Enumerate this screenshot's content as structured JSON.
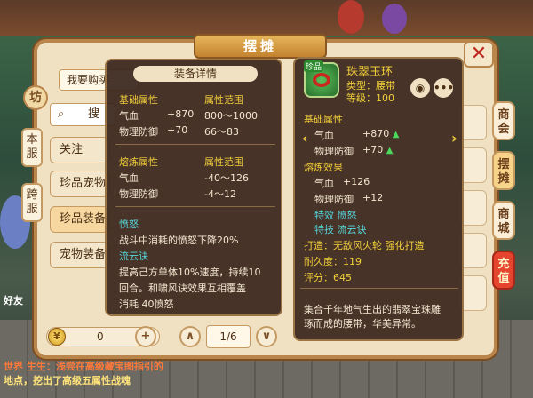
{
  "window": {
    "title": "摆摊"
  },
  "close_icon": "close-x",
  "shop_badge": "坊",
  "left_tabs": [
    "本服",
    "跨服"
  ],
  "want_buy": "我要购买",
  "search": {
    "label": "搜"
  },
  "categories": [
    {
      "label": "关注"
    },
    {
      "label": "珍品宠物"
    },
    {
      "label": "珍品装备"
    },
    {
      "label": "宠物装备"
    }
  ],
  "side_nav": [
    "商会",
    "摆摊",
    "商城",
    "充值"
  ],
  "bottom": {
    "gold_value": "0",
    "add_label": "+",
    "page": "1/6",
    "prev_label": "∧",
    "next_label": "∨"
  },
  "detail": {
    "header": "装备详情",
    "base_title": "基础属性",
    "range_title": "属性范围",
    "base": [
      {
        "name": "气血",
        "value": "+870",
        "range": "800～1000"
      },
      {
        "name": "物理防御",
        "value": "+70",
        "range": "66～83"
      }
    ],
    "refine_title": "熔炼属性",
    "refine_range_title": "属性范围",
    "refine": [
      {
        "name": "气血",
        "range": "-40～126"
      },
      {
        "name": "物理防御",
        "range": "-4～12"
      }
    ],
    "anger_title": "愤怒",
    "anger_text": "战斗中消耗的愤怒下降20%",
    "flow_title": "流云诀",
    "flow_text1": "提高己方单体10%速度，持续10",
    "flow_text2": "回合。和啸风诀效果互相覆盖",
    "flow_text3": "消耗 40愤怒"
  },
  "item": {
    "name": "珠翠玉环",
    "type": "类型：腰带",
    "level": "等级：100",
    "icon_tag": "珍品",
    "base_title": "基础属性",
    "base": [
      {
        "name": "气血",
        "value": "+870"
      },
      {
        "name": "物理防御",
        "value": "+70"
      }
    ],
    "refine_title": "熔炼效果",
    "refine": [
      {
        "name": "气血",
        "value": "+126"
      },
      {
        "name": "物理防御",
        "value": "+12"
      }
    ],
    "effect": "特效 愤怒",
    "skill": "特技 流云诀",
    "forge": "打造：无敌风火轮  强化打造",
    "durability": "耐久度：119",
    "score": "评分：645",
    "desc1": "集合千年地气生出的翡翠宝珠雕",
    "desc2": "琢而成的腰带，华美异常。",
    "eye_icon": "eye",
    "more_icon": "more"
  },
  "chat": {
    "line1": "世界 生生：浅尝在高级藏宝图指引的",
    "line2": "地点，挖出了高级五属性战魂",
    "friend": "好友"
  },
  "colors": {
    "panel": "#efe1c2",
    "popup": "#3a261c",
    "gold": "#f2cf3a",
    "cyan": "#55d6dc",
    "red": "#e5452e"
  }
}
